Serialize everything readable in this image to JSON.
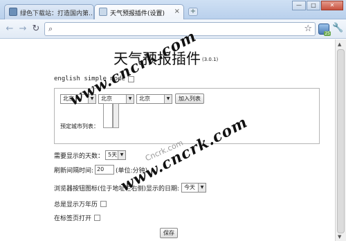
{
  "browser": {
    "tabs": [
      {
        "label": "绿色下载站：打造国内第…",
        "active": false
      },
      {
        "label": "天气预报插件(设置)",
        "active": true
      }
    ],
    "new_tab_label": "+",
    "window_buttons": [
      "—",
      "□",
      "✕"
    ],
    "address": "",
    "ext_badge": "25"
  },
  "page": {
    "title": "天气预报插件",
    "version": "(3.0.1)",
    "english_mode_label": "english simple mode",
    "city": {
      "province": "北京",
      "city": "北京",
      "district": "北京",
      "add_button": "加入列表",
      "list_label": "预定城市列表："
    },
    "days_label": "需要显示的天数：",
    "days_value": "5天",
    "refresh_label": "刷新间隔时间:",
    "refresh_value": "20",
    "refresh_unit": "(单位:分钟)",
    "icon_label": "浏览器按钮图标(位于地址栏右侧)显示的日期:",
    "icon_value": "今天",
    "calendar_label": "总是显示万年历",
    "newtab_label": "在标签页打开",
    "save_button": "保存"
  },
  "watermarks": [
    "www.cncrk.com",
    "www.cncrk.com",
    "Cncrk.com"
  ]
}
